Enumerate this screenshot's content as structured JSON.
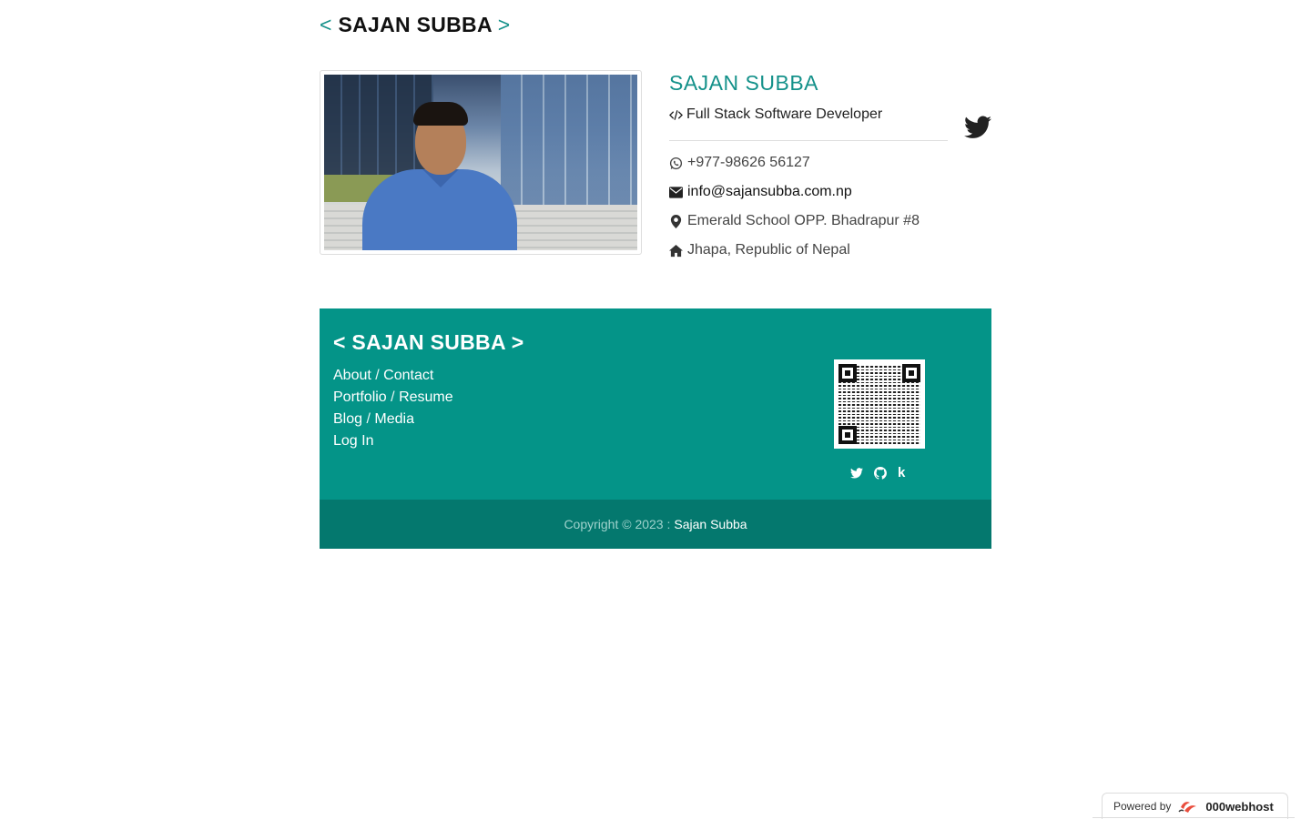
{
  "header": {
    "bracket_open": "<",
    "name": "SAJAN SUBBA",
    "bracket_close": ">"
  },
  "profile": {
    "name": "SAJAN SUBBA",
    "job_title": "Full Stack Software Developer",
    "phone": "+977-98626 56127",
    "email": "info@sajansubba.com.np",
    "address_line1": "Emerald School OPP. Bhadrapur #8",
    "address_line2": "Jhapa, Republic of Nepal",
    "icons": {
      "job": "code-icon",
      "phone": "whatsapp-icon",
      "email": "envelope-icon",
      "address": "map-marker-icon",
      "home": "home-icon",
      "social": "twitter-icon"
    }
  },
  "footer": {
    "title": "< SAJAN SUBBA >",
    "links": [
      [
        "About",
        "Contact"
      ],
      [
        "Portfolio",
        "Resume"
      ],
      [
        "Blog",
        "Media"
      ],
      [
        "Log In"
      ]
    ],
    "link_separator": "/",
    "social_icons": [
      "twitter-icon",
      "github-icon",
      "k-icon"
    ],
    "k_label": "k"
  },
  "copyright": {
    "text": "Copyright © 2023 :",
    "owner": "Sajan Subba"
  },
  "powered_badge": {
    "prefix": "Powered by",
    "brand": "000webhost"
  },
  "colors": {
    "accent": "#14918a",
    "footer_bg": "#049488",
    "copyright_bg": "#04786e"
  }
}
